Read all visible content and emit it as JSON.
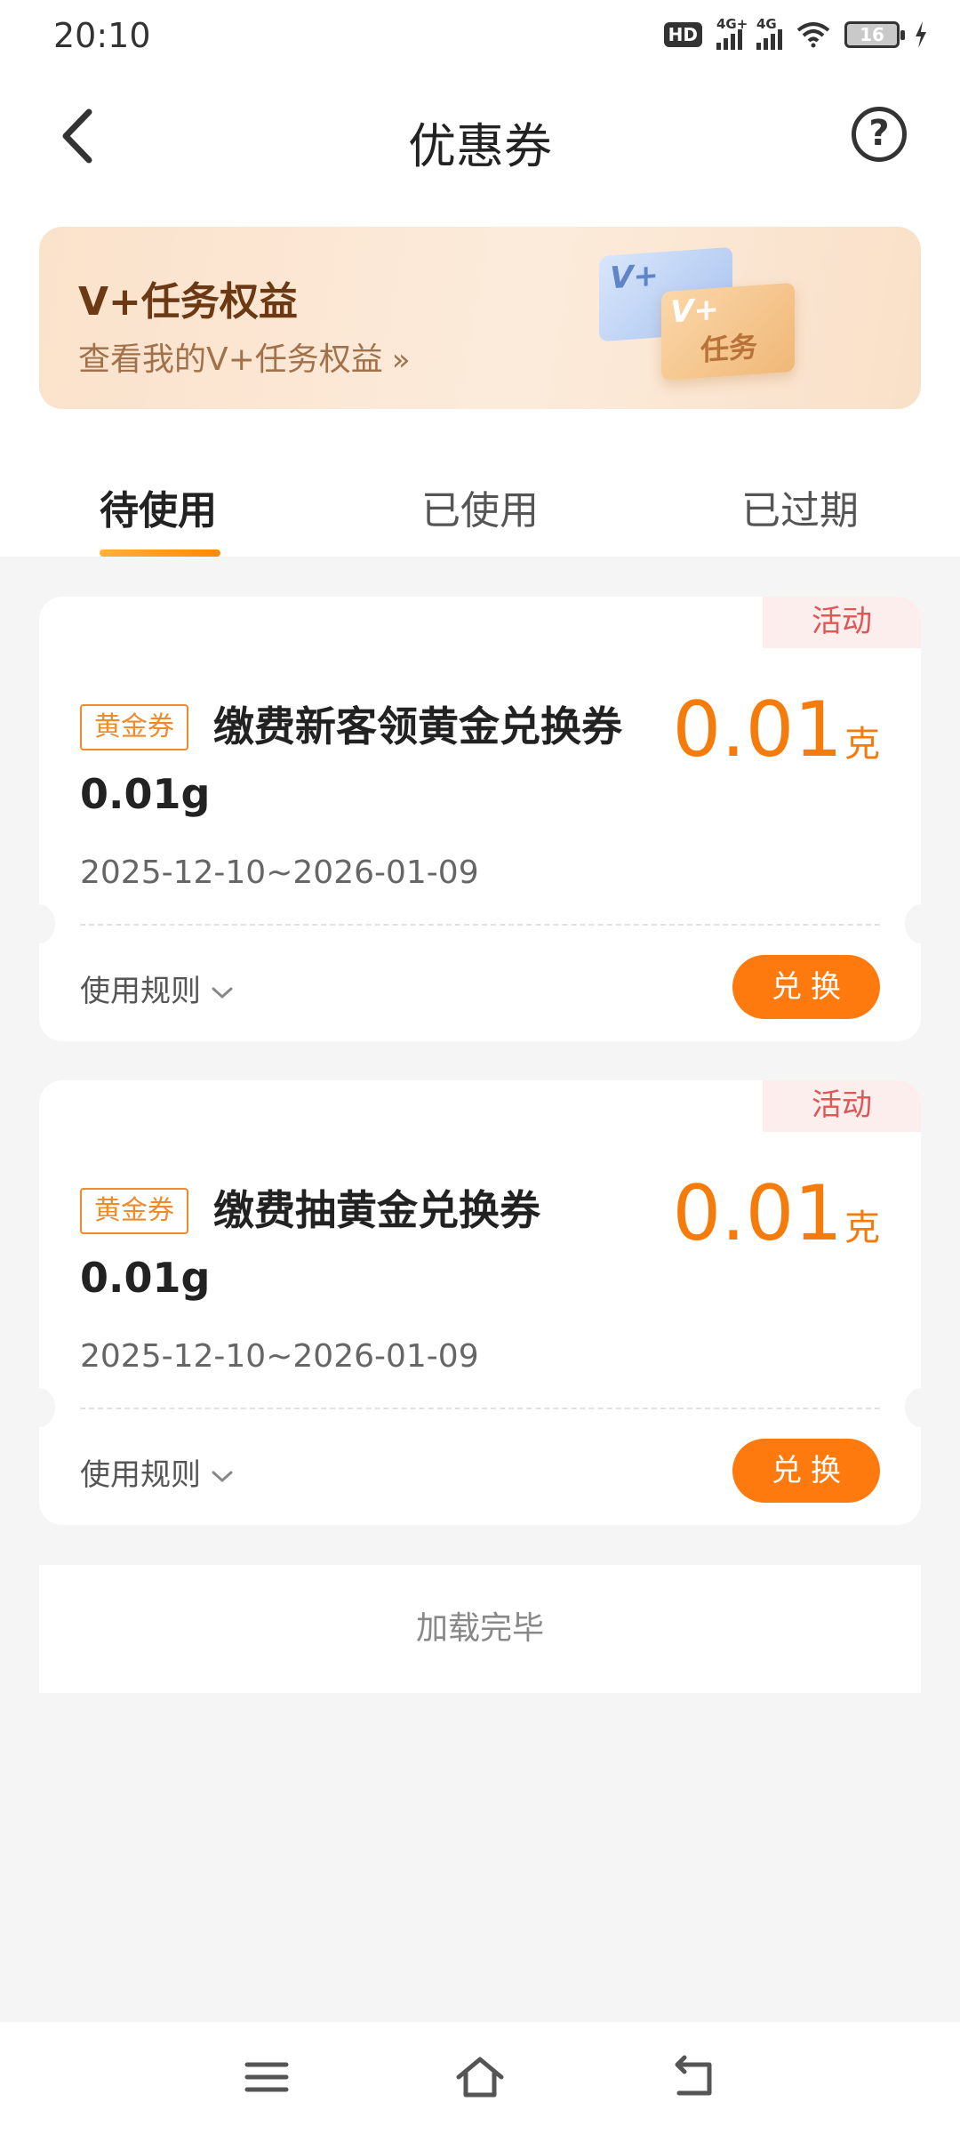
{
  "status_bar": {
    "time": "20:10",
    "hd_label": "HD",
    "signal1_label": "4G+",
    "signal2_label": "4G",
    "battery": "16"
  },
  "header": {
    "title": "优惠券",
    "back_icon": "chevron-left-icon",
    "help_icon": "question-circle-icon",
    "help_glyph": "?"
  },
  "banner": {
    "title": "V+任务权益",
    "subtitle": "查看我的V+任务权益",
    "arrow": "»",
    "card_back_label": "V+",
    "card_front_label_v": "V+",
    "card_front_label_text": "任务"
  },
  "tabs": [
    {
      "label": "待使用",
      "active": true
    },
    {
      "label": "已使用",
      "active": false
    },
    {
      "label": "已过期",
      "active": false
    }
  ],
  "coupons": [
    {
      "tag": "活动",
      "badge": "黄金券",
      "title": "缴费新客领黄金兑换券0.01g",
      "amount": "0.01",
      "unit": "克",
      "date_range": "2025-12-10~2026-01-09",
      "rules_label": "使用规则",
      "action_label": "兑换"
    },
    {
      "tag": "活动",
      "badge": "黄金券",
      "title": "缴费抽黄金兑换券0.01g",
      "amount": "0.01",
      "unit": "克",
      "date_range": "2025-12-10~2026-01-09",
      "rules_label": "使用规则",
      "action_label": "兑换"
    }
  ],
  "footer_text": "加载完毕",
  "colors": {
    "accent": "#ff7a0e",
    "amount": "#f57c0b",
    "tag_text": "#e05555"
  },
  "nav_icons": [
    "menu-icon",
    "home-icon",
    "back-icon"
  ]
}
